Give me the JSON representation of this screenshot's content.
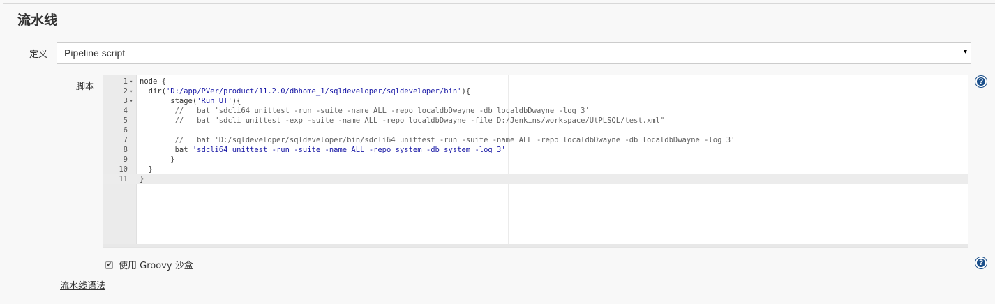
{
  "section": {
    "title": "流水线"
  },
  "definition": {
    "label": "定义",
    "selected": "Pipeline script",
    "arrow_icon": "▾"
  },
  "script": {
    "label": "脚本",
    "lines": [
      {
        "num": "1",
        "fold": "▾",
        "code": "node {"
      },
      {
        "num": "2",
        "fold": "▾",
        "code": "  dir('D:/app/PVer/product/11.2.0/dbhome_1/sqldeveloper/sqldeveloper/bin'){"
      },
      {
        "num": "3",
        "fold": "▾",
        "code": "       stage('Run UT'){"
      },
      {
        "num": "4",
        "fold": "",
        "code": "        //   bat 'sdcli64 unittest -run -suite -name ALL -repo localdbDwayne -db localdbDwayne -log 3'"
      },
      {
        "num": "5",
        "fold": "",
        "code": "        //   bat \"sdcli unittest -exp -suite -name ALL -repo localdbDwayne -file D:/Jenkins/workspace/UtPLSQL/test.xml\""
      },
      {
        "num": "6",
        "fold": "",
        "code": ""
      },
      {
        "num": "7",
        "fold": "",
        "code": "        //   bat 'D:/sqldeveloper/sqldeveloper/bin/sdcli64 unittest -run -suite -name ALL -repo localdbDwayne -db localdbDwayne -log 3'"
      },
      {
        "num": "8",
        "fold": "",
        "code": "        bat 'sdcli64 unittest -run -suite -name ALL -repo system -db system -log 3'"
      },
      {
        "num": "9",
        "fold": "",
        "code": "       }"
      },
      {
        "num": "10",
        "fold": "",
        "code": "  }"
      },
      {
        "num": "11",
        "fold": "",
        "code": "}"
      }
    ],
    "active_line": 11
  },
  "sandbox": {
    "label": "使用 Groovy 沙盒",
    "checked": true,
    "check_glyph": "✔"
  },
  "syntax_link": {
    "label": "流水线语法"
  },
  "help": {
    "glyph": "?"
  }
}
